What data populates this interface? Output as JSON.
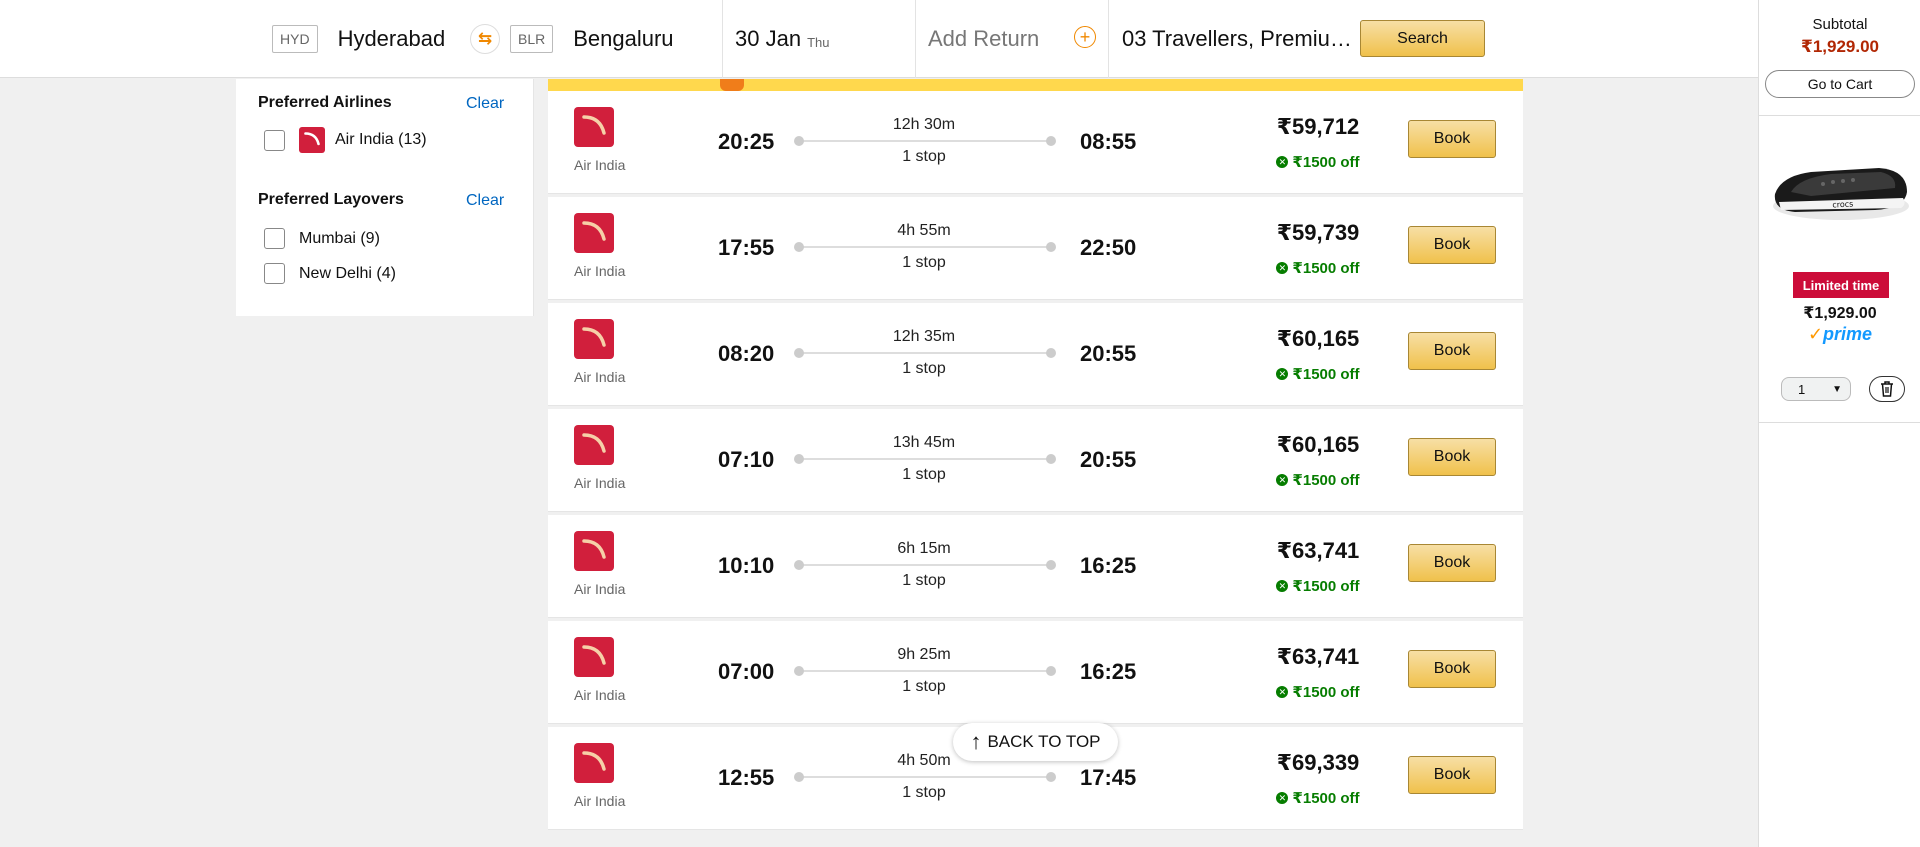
{
  "search": {
    "from_code": "HYD",
    "from_city": "Hyderabad",
    "to_code": "BLR",
    "to_city": "Bengaluru",
    "date": "30 Jan",
    "day": "Thu",
    "return_placeholder": "Add Return",
    "travellers": "03 Travellers, Premiu…",
    "search_label": "Search"
  },
  "filters": {
    "airlines": {
      "title": "Preferred Airlines",
      "clear": "Clear",
      "items": [
        {
          "label": "Air India (13)"
        }
      ]
    },
    "layovers": {
      "title": "Preferred Layovers",
      "clear": "Clear",
      "items": [
        {
          "label": "Mumbai (9)"
        },
        {
          "label": "New Delhi (4)"
        }
      ]
    }
  },
  "flights": [
    {
      "airline": "Air India",
      "dep": "20:25",
      "duration": "12h 30m",
      "stops": "1 stop",
      "arr": "08:55",
      "price": "₹59,712",
      "discount": "₹1500 off",
      "book": "Book"
    },
    {
      "airline": "Air India",
      "dep": "17:55",
      "duration": "4h 55m",
      "stops": "1 stop",
      "arr": "22:50",
      "price": "₹59,739",
      "discount": "₹1500 off",
      "book": "Book"
    },
    {
      "airline": "Air India",
      "dep": "08:20",
      "duration": "12h 35m",
      "stops": "1 stop",
      "arr": "20:55",
      "price": "₹60,165",
      "discount": "₹1500 off",
      "book": "Book"
    },
    {
      "airline": "Air India",
      "dep": "07:10",
      "duration": "13h 45m",
      "stops": "1 stop",
      "arr": "20:55",
      "price": "₹60,165",
      "discount": "₹1500 off",
      "book": "Book"
    },
    {
      "airline": "Air India",
      "dep": "10:10",
      "duration": "6h 15m",
      "stops": "1 stop",
      "arr": "16:25",
      "price": "₹63,741",
      "discount": "₹1500 off",
      "book": "Book"
    },
    {
      "airline": "Air India",
      "dep": "07:00",
      "duration": "9h 25m",
      "stops": "1 stop",
      "arr": "16:25",
      "price": "₹63,741",
      "discount": "₹1500 off",
      "book": "Book"
    },
    {
      "airline": "Air India",
      "dep": "12:55",
      "duration": "4h 50m",
      "stops": "1 stop",
      "arr": "17:45",
      "price": "₹69,339",
      "discount": "₹1500 off",
      "book": "Book"
    }
  ],
  "back_to_top": "BACK TO TOP",
  "cart": {
    "subtotal_label": "Subtotal",
    "subtotal_value": "₹1,929.00",
    "go_to_cart": "Go to Cart",
    "badge": "Limited time",
    "item_price": "₹1,929.00",
    "prime_label": "prime",
    "quantity": "1"
  },
  "colors": {
    "accent_orange": "#f08800",
    "button_yellow": "#f0c14b",
    "air_india_red": "#d11f3c",
    "discount_green": "#067d00",
    "price_red": "#b12704",
    "link_blue": "#0066c0"
  }
}
